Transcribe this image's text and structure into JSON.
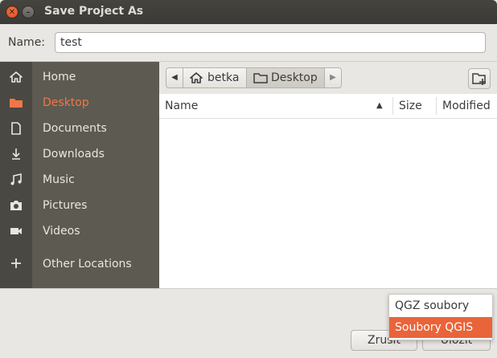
{
  "window": {
    "title": "Save Project As"
  },
  "name_row": {
    "label": "Name:",
    "value": "test"
  },
  "sidebar": {
    "items": [
      {
        "label": "Home",
        "icon": "home-icon"
      },
      {
        "label": "Desktop",
        "icon": "folder-icon",
        "active": true
      },
      {
        "label": "Documents",
        "icon": "document-icon"
      },
      {
        "label": "Downloads",
        "icon": "download-icon"
      },
      {
        "label": "Music",
        "icon": "music-icon"
      },
      {
        "label": "Pictures",
        "icon": "camera-icon"
      },
      {
        "label": "Videos",
        "icon": "video-icon"
      },
      {
        "label": "Other Locations",
        "icon": "plus-icon"
      }
    ]
  },
  "pathbar": {
    "crumbs": [
      "betka",
      "Desktop"
    ]
  },
  "columns": {
    "name": "Name",
    "size": "Size",
    "modified": "Modified"
  },
  "filter": {
    "options": [
      "QGZ soubory",
      "Soubory QGIS"
    ],
    "selected": "Soubory QGIS"
  },
  "buttons": {
    "cancel": "Zrušit",
    "save": "Uložit"
  },
  "colors": {
    "accent": "#e9643a",
    "sidebar_bg": "#5d5a51",
    "titlebar_bg": "#3b3a36"
  }
}
